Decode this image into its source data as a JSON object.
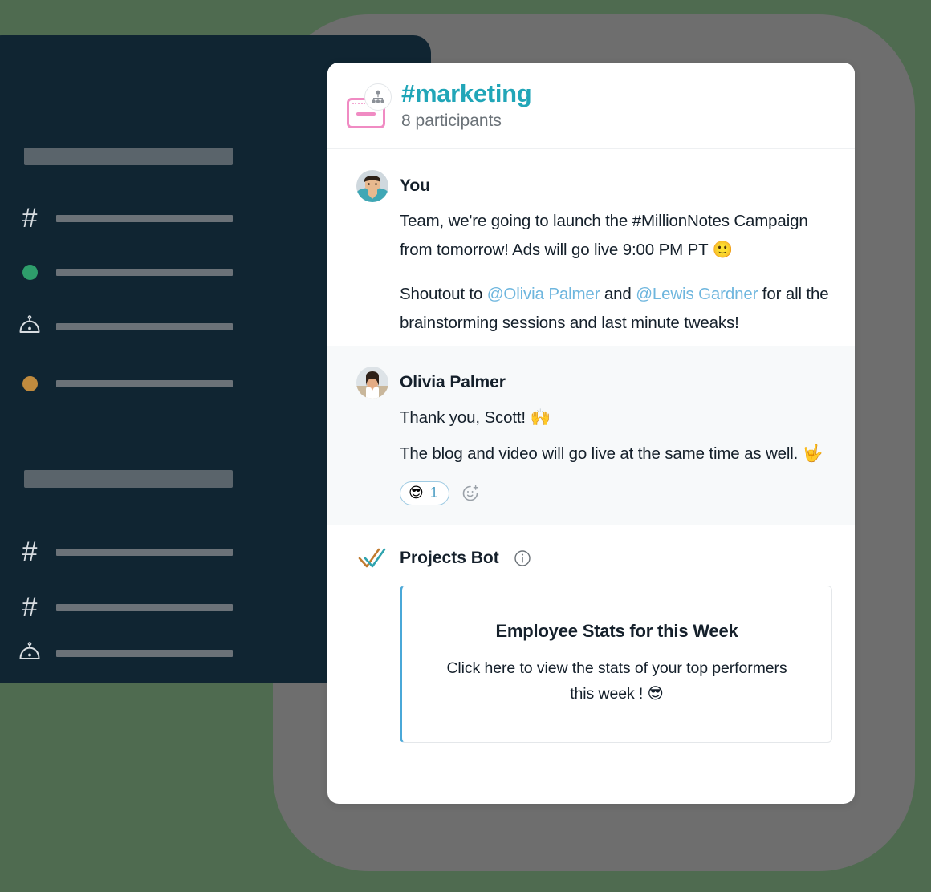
{
  "background": {
    "page_color": "#4f6b50",
    "backdrop_color": "#6e6e6e"
  },
  "sidebar": {
    "panel_color": "#102532",
    "section_placeholders": [
      {
        "name": "workspace-title-placeholder"
      },
      {
        "name": "channels-section-placeholder"
      }
    ],
    "items": [
      {
        "icon": "hash-icon",
        "label_placeholder": true,
        "accent": "#d8dde1"
      },
      {
        "icon": "status-dot-icon",
        "label_placeholder": true,
        "accent": "#2e9e6b"
      },
      {
        "icon": "bot-icon",
        "label_placeholder": true,
        "accent": "#d8dde1"
      },
      {
        "icon": "status-dot-icon",
        "label_placeholder": true,
        "accent": "#c08b3e"
      },
      {
        "icon": "hash-icon",
        "label_placeholder": true,
        "accent": "#d8dde1"
      },
      {
        "icon": "hash-icon",
        "label_placeholder": true,
        "accent": "#d8dde1"
      },
      {
        "icon": "bot-icon",
        "label_placeholder": true,
        "accent": "#d8dde1"
      }
    ]
  },
  "chat": {
    "header": {
      "channel_icon": "window-card-icon",
      "badge_icon": "people-group-icon",
      "channel_name": "#marketing",
      "channel_name_color": "#21a6b8",
      "participants": "8 participants"
    },
    "messages": [
      {
        "id": "message-you",
        "avatar": "user-avatar-scott",
        "author": "You",
        "tinted": false,
        "paragraphs": [
          {
            "parts": [
              {
                "type": "text",
                "value": "Team, we're going to launch the #MillionNotes Campaign from tomorrow!  Ads will go live 9:00 PM PT "
              },
              {
                "type": "emoji",
                "value": "🙂"
              }
            ]
          },
          {
            "parts": [
              {
                "type": "text",
                "value": "Shoutout to "
              },
              {
                "type": "mention",
                "value": "@Olivia Palmer"
              },
              {
                "type": "text",
                "value": " and "
              },
              {
                "type": "mention",
                "value": "@Lewis Gardner"
              },
              {
                "type": "text",
                "value": " for all the  brainstorming sessions and last minute tweaks!"
              }
            ]
          }
        ],
        "reactions": []
      },
      {
        "id": "message-olivia",
        "avatar": "user-avatar-olivia",
        "author": "Olivia  Palmer",
        "tinted": true,
        "paragraphs": [
          {
            "parts": [
              {
                "type": "text",
                "value": "Thank you, Scott! "
              },
              {
                "type": "emoji",
                "value": "🙌"
              }
            ]
          },
          {
            "parts": [
              {
                "type": "text",
                "value": "The blog and video will go live at the same time as well. "
              },
              {
                "type": "emoji",
                "value": "🤟"
              }
            ]
          }
        ],
        "reactions": [
          {
            "emoji": "😎",
            "count": "1",
            "count_color": "#4e9fc4",
            "border_color": "#9fcbe3"
          }
        ],
        "add_reaction_icon": "add-reaction-icon"
      }
    ],
    "bot_message": {
      "icon": "double-check-icon",
      "name": "Projects Bot",
      "info_icon": "info-icon",
      "card": {
        "accent_color": "#4aa8d8",
        "title": "Employee Stats for this Week",
        "body_text": "Click here to view the stats of your top performers this week ! ",
        "body_emoji": "😎"
      }
    }
  }
}
